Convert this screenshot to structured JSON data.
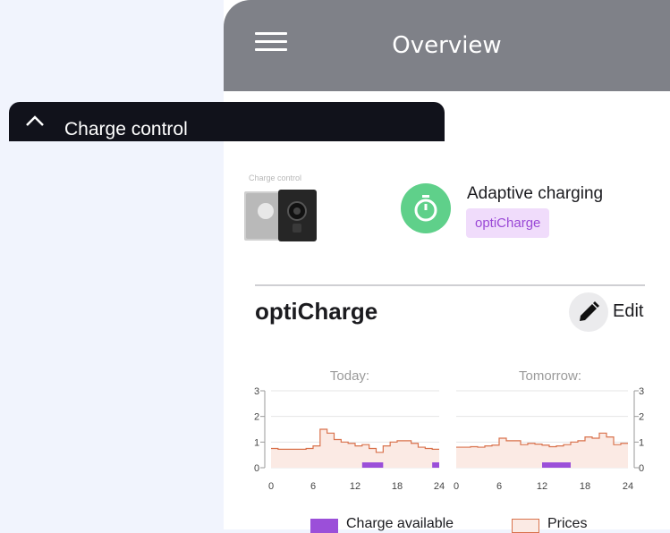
{
  "header": {
    "title": "Overview",
    "menu_icon": "hamburger-menu-icon"
  },
  "card": {
    "title": "Charge control",
    "collapse_icon": "chevron-up-icon",
    "thumbnail_label": "Charge control",
    "mode": {
      "title": "Adaptive charging",
      "badge": "optiCharge",
      "icon": "timer-icon"
    }
  },
  "section": {
    "title": "optiCharge",
    "edit_label": "Edit",
    "edit_icon": "pencil-icon"
  },
  "colors": {
    "header": "#7f8188",
    "card_top": "#11121b",
    "mode": "#5fd08a",
    "charge": "#9b4fd9",
    "price_line": "#d9724c",
    "price_fill": "#fbeae4"
  },
  "legend": {
    "charge": "Charge available",
    "prices": "Prices"
  },
  "chart_data": [
    {
      "type": "area",
      "title": "Today:",
      "x_ticks": [
        "0",
        "6",
        "12",
        "18",
        "24"
      ],
      "y_ticks": [
        "0",
        "1",
        "2",
        "3"
      ],
      "ylim": [
        0,
        3
      ],
      "xlim": [
        0,
        24
      ],
      "series": [
        {
          "name": "Prices",
          "type": "step",
          "values": [
            0.75,
            0.72,
            0.72,
            0.72,
            0.72,
            0.75,
            0.85,
            1.5,
            1.35,
            1.1,
            1.0,
            0.95,
            0.85,
            0.9,
            0.75,
            0.6,
            0.85,
            1.0,
            1.05,
            1.05,
            0.95,
            0.8,
            0.75,
            0.72
          ]
        },
        {
          "name": "Charge available",
          "type": "bar",
          "ranges": [
            [
              13,
              16
            ],
            [
              23,
              24
            ]
          ]
        }
      ]
    },
    {
      "type": "area",
      "title": "Tomorrow:",
      "x_ticks": [
        "0",
        "6",
        "12",
        "18",
        "24"
      ],
      "y_ticks": [
        "0",
        "1",
        "2",
        "3"
      ],
      "ylim": [
        0,
        3
      ],
      "xlim": [
        0,
        24
      ],
      "series": [
        {
          "name": "Prices",
          "type": "step",
          "values": [
            0.8,
            0.8,
            0.82,
            0.8,
            0.85,
            0.88,
            1.15,
            1.05,
            1.05,
            0.9,
            0.95,
            0.92,
            0.88,
            0.82,
            0.85,
            0.9,
            1.0,
            1.05,
            1.2,
            1.15,
            1.35,
            1.2,
            0.9,
            0.95
          ]
        },
        {
          "name": "Charge available",
          "type": "bar",
          "ranges": [
            [
              12,
              16
            ]
          ]
        }
      ]
    }
  ]
}
